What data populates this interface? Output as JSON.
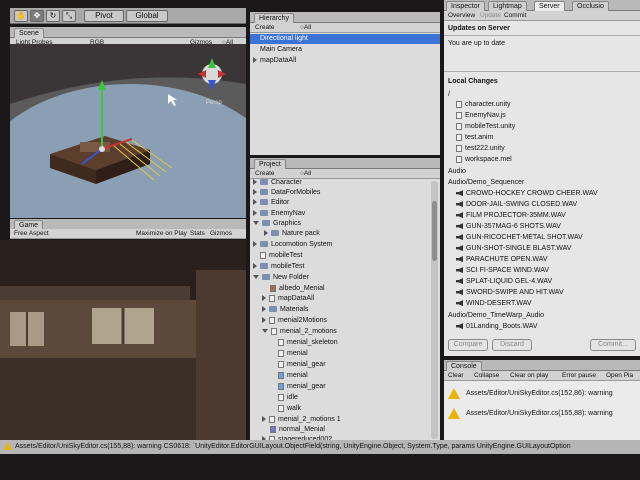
{
  "toolbar": {
    "pivot": "Pivot",
    "global": "Global"
  },
  "scene": {
    "tab": "Scene",
    "light_probes": "Light Probes",
    "render_mode": "RGB",
    "gizmos": "Gizmos",
    "search": "○All",
    "persp": "Persp"
  },
  "game": {
    "tab": "Game",
    "aspect": "Free Aspect",
    "maximize": "Maximize on Play",
    "stats": "Stats",
    "gizmos": "Gizmos"
  },
  "hierarchy": {
    "tab": "Hierarchy",
    "create": "Create",
    "search": "○All",
    "items": [
      "Directional light",
      "Main Camera",
      "mapDataAll"
    ]
  },
  "project": {
    "tab": "Project",
    "create": "Create",
    "search": "○All",
    "items": [
      "Character",
      "DataForMobiles",
      "Editor",
      "EnemyNav",
      "Graphics",
      "Nature pack",
      "Locomotion System",
      "mobileTest",
      "mobileTest",
      "New Folder",
      "albedo_Menial",
      "mapDataAll",
      "Materials",
      "menial2Motions",
      "menial_2_motions",
      "menial_skeleton",
      "menial",
      "menial_gear",
      "menial",
      "menial_gear",
      "idle",
      "walk",
      "menial_2_motions 1",
      "normal_Menial",
      "stagereduced002",
      "testBox"
    ]
  },
  "right_tabs": {
    "inspector": "Inspector",
    "lightmap": "Lightmap",
    "server": "Server",
    "extra": "Occlusio"
  },
  "server": {
    "tabs": [
      "Overview",
      "Update",
      "Commit"
    ],
    "updates_header": "Updates on Server",
    "up_to_date": "You are up to date",
    "local_changes_header": "Local Changes",
    "root": "/",
    "root_files": [
      "character.unity",
      "EnemyNav.js",
      "mobileTest.unity",
      "test.anim",
      "test222.unity",
      "workspace.mel"
    ],
    "audio": "Audio",
    "demo_sequencer": "Audio/Demo_Sequencer",
    "sequencer_files": [
      "CROWD-HOCKEY CROWD CHEER.WAV",
      "DOOR-JAIL-SWING CLOSED.WAV",
      "FILM PROJECTOR-35MM.WAV",
      "GUN-357MAG-6 SHOTS.WAV",
      "GUN-RICOCHET-METAL SHOT.WAV",
      "GUN-SHOT-SINGLE BLAST.WAV",
      "PARACHUTE OPEN.WAV",
      "SCI FI-SPACE WIND.WAV",
      "SPLAT-LIQUID GEL-4.WAV",
      "SWORD-SWIPE AND HIT.WAV",
      "WIND-DESERT.WAV"
    ],
    "demo_timewarp": "Audio/Demo_TimeWarp_Audio",
    "timewarp_files": [
      "01Landing_Boots.WAV"
    ],
    "buttons": {
      "compare": "Compare",
      "discard": "Discard",
      "commit": "Commit..."
    }
  },
  "console": {
    "tab": "Console",
    "buttons": [
      "Clear",
      "Collapse",
      "Clear on play",
      "Error pause",
      "Open Pla"
    ],
    "messages": [
      "Assets/Editor/UniSkyEditor.cs(152,86): warning",
      "Assets/Editor/UniSkyEditor.cs(155,88): warning"
    ]
  },
  "status_bar": {
    "text": "Assets/Editor/UniSkyEditor.cs(155,88): warning CS0618: `UnityEditor.EditorGUILayout.ObjectField(string, UnityEngine.Object, System.Type, params UnityEngine.GUILayoutOption"
  },
  "colors": {
    "selection": "#3b74d6",
    "warning": "#e8b600",
    "panel": "#dcdcdc"
  }
}
